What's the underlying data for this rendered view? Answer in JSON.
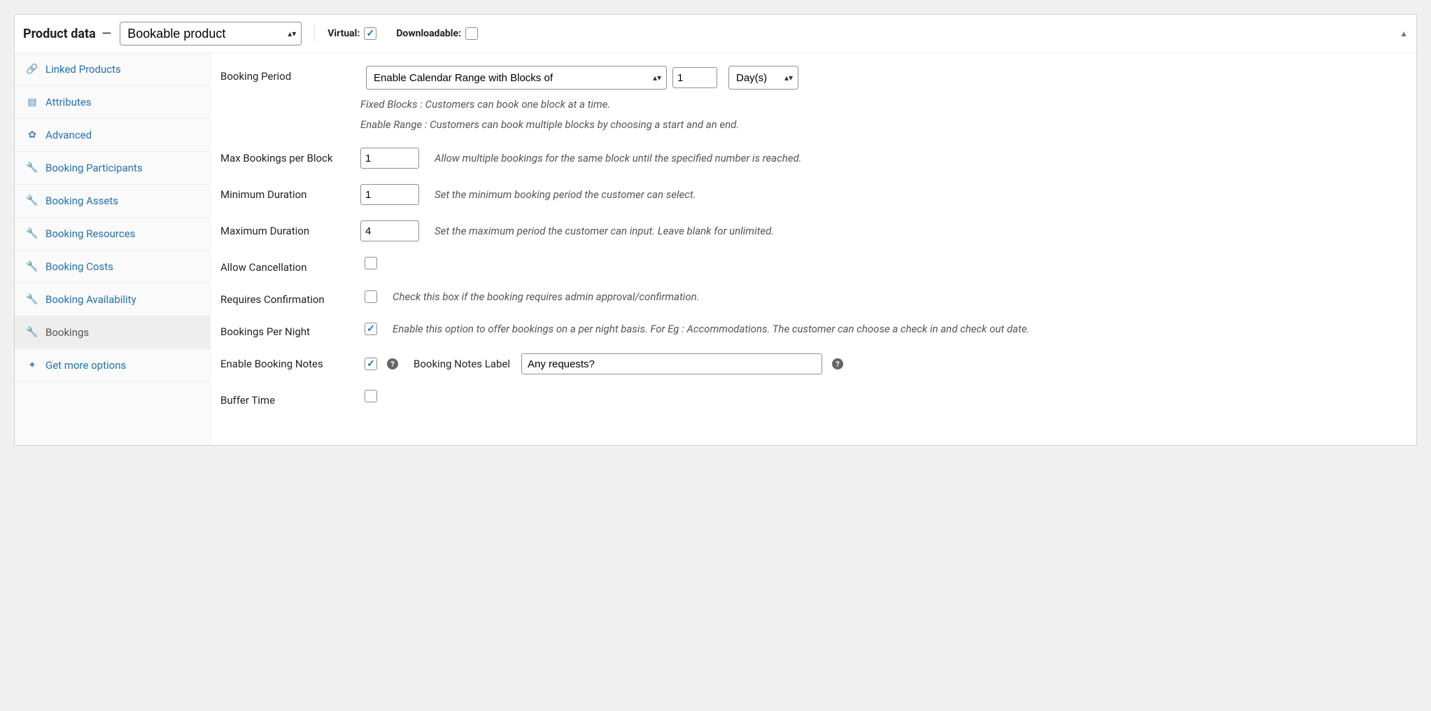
{
  "header": {
    "title_prefix": "Product data",
    "dash": "—",
    "product_type": "Bookable product",
    "virtual_label": "Virtual:",
    "virtual_checked": true,
    "downloadable_label": "Downloadable:",
    "downloadable_checked": false
  },
  "sidebar": {
    "items": [
      {
        "icon": "link-icon",
        "label": "Linked Products",
        "active": false
      },
      {
        "icon": "list-icon",
        "label": "Attributes",
        "active": false
      },
      {
        "icon": "gear-icon",
        "label": "Advanced",
        "active": false
      },
      {
        "icon": "wrench-icon",
        "label": "Booking Participants",
        "active": false
      },
      {
        "icon": "wrench-icon",
        "label": "Booking Assets",
        "active": false
      },
      {
        "icon": "wrench-icon",
        "label": "Booking Resources",
        "active": false
      },
      {
        "icon": "wrench-icon",
        "label": "Booking Costs",
        "active": false
      },
      {
        "icon": "wrench-icon",
        "label": "Booking Availability",
        "active": false
      },
      {
        "icon": "wrench-icon",
        "label": "Bookings",
        "active": true
      },
      {
        "icon": "sparkle-icon",
        "label": "Get more options",
        "active": false
      }
    ]
  },
  "form": {
    "booking_period": {
      "label": "Booking Period",
      "mode": "Enable Calendar Range with Blocks of",
      "blocks": "1",
      "unit": "Day(s)",
      "hint1": "Fixed Blocks : Customers can book one block at a time.",
      "hint2": "Enable Range : Customers can book multiple blocks by choosing a start and an end."
    },
    "max_bookings": {
      "label": "Max Bookings per Block",
      "value": "1",
      "hint": "Allow multiple bookings for the same block until the specified number is reached."
    },
    "min_duration": {
      "label": "Minimum Duration",
      "value": "1",
      "hint": "Set the minimum booking period the customer can select."
    },
    "max_duration": {
      "label": "Maximum Duration",
      "value": "4",
      "hint": "Set the maximum period the customer can input. Leave blank for unlimited."
    },
    "allow_cancel": {
      "label": "Allow Cancellation",
      "checked": false
    },
    "requires_confirm": {
      "label": "Requires Confirmation",
      "checked": false,
      "hint": "Check this box if the booking requires admin approval/confirmation."
    },
    "per_night": {
      "label": "Bookings Per Night",
      "checked": true,
      "hint": "Enable this option to offer bookings on a per night basis. For Eg : Accommodations. The customer can choose a check in and check out date."
    },
    "notes": {
      "label": "Enable Booking Notes",
      "checked": true,
      "inner_label": "Booking Notes Label",
      "value": "Any requests?"
    },
    "buffer": {
      "label": "Buffer Time",
      "checked": false
    }
  }
}
